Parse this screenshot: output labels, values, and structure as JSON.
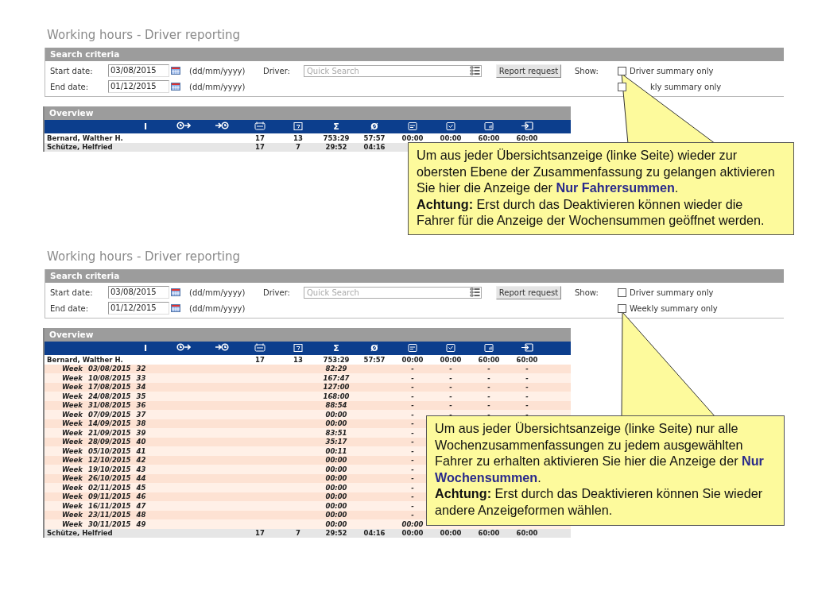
{
  "screens": [
    {
      "title": "Working hours - Driver reporting",
      "search": {
        "heading": "Search criteria",
        "start_label": "Start date:",
        "start_value": "03/08/2015",
        "start_format": "(dd/mm/yyyy)",
        "end_label": "End date:",
        "end_value": "01/12/2015",
        "end_format": "(dd/mm/yyyy)",
        "driver_label": "Driver:",
        "driver_placeholder": "Quick Search",
        "button": "Report request",
        "show_label": "Show:",
        "options": [
          {
            "label": "Driver summary only",
            "checked": false
          },
          {
            "label": "kly summary only",
            "checked": false
          }
        ]
      },
      "overview": {
        "heading": "Overview",
        "columns": [
          {
            "kind": "text",
            "label": "I"
          },
          {
            "kind": "icon"
          },
          {
            "kind": "icon"
          },
          {
            "kind": "icon"
          },
          {
            "kind": "icon"
          },
          {
            "kind": "text",
            "label": "Σ"
          },
          {
            "kind": "text",
            "label": "Ø"
          },
          {
            "kind": "icon"
          },
          {
            "kind": "icon"
          },
          {
            "kind": "icon"
          },
          {
            "kind": "icon"
          }
        ],
        "rows": [
          {
            "kind": "driver",
            "name": "Bernard, Walther H.",
            "cells": [
              null,
              null,
              null,
              "17",
              "13",
              "753:29",
              "57:57",
              "00:00",
              "00:00",
              "60:00",
              "60:00"
            ]
          },
          {
            "kind": "driver",
            "name": "Schütze, Helfried",
            "cells": [
              null,
              null,
              null,
              "17",
              "7",
              "29:52",
              "04:16",
              null,
              null,
              null,
              null
            ]
          }
        ]
      }
    },
    {
      "title": "Working hours - Driver reporting",
      "search": {
        "heading": "Search criteria",
        "start_label": "Start date:",
        "start_value": "03/08/2015",
        "start_format": "(dd/mm/yyyy)",
        "end_label": "End date:",
        "end_value": "01/12/2015",
        "end_format": "(dd/mm/yyyy)",
        "driver_label": "Driver:",
        "driver_placeholder": "Quick Search",
        "button": "Report request",
        "show_label": "Show:",
        "options": [
          {
            "label": "Driver summary only",
            "checked": false
          },
          {
            "label": "Weekly summary only",
            "checked": false
          }
        ]
      },
      "overview": {
        "heading": "Overview",
        "columns": [
          {
            "kind": "text",
            "label": "I"
          },
          {
            "kind": "icon"
          },
          {
            "kind": "icon"
          },
          {
            "kind": "icon"
          },
          {
            "kind": "icon"
          },
          {
            "kind": "text",
            "label": "Σ"
          },
          {
            "kind": "text",
            "label": "Ø"
          },
          {
            "kind": "icon"
          },
          {
            "kind": "icon"
          },
          {
            "kind": "icon"
          },
          {
            "kind": "icon"
          }
        ],
        "rows": [
          {
            "kind": "driver",
            "name": "Bernard, Walther H.",
            "cells": [
              null,
              null,
              null,
              "17",
              "13",
              "753:29",
              "57:57",
              "00:00",
              "00:00",
              "60:00",
              "60:00"
            ]
          },
          {
            "kind": "week",
            "label": "Week",
            "date": "03/08/2015",
            "number": "32",
            "cells": [
              null,
              null,
              null,
              null,
              null,
              "82:29",
              null,
              "-",
              "-",
              "-",
              "-"
            ]
          },
          {
            "kind": "week",
            "label": "Week",
            "date": "10/08/2015",
            "number": "33",
            "cells": [
              null,
              null,
              null,
              null,
              null,
              "167:47",
              null,
              "-",
              "-",
              "-",
              "-"
            ]
          },
          {
            "kind": "week",
            "label": "Week",
            "date": "17/08/2015",
            "number": "34",
            "cells": [
              null,
              null,
              null,
              null,
              null,
              "127:00",
              null,
              "-",
              "-",
              "-",
              "-"
            ]
          },
          {
            "kind": "week",
            "label": "Week",
            "date": "24/08/2015",
            "number": "35",
            "cells": [
              null,
              null,
              null,
              null,
              null,
              "168:00",
              null,
              "-",
              "-",
              "-",
              "-"
            ]
          },
          {
            "kind": "week",
            "label": "Week",
            "date": "31/08/2015",
            "number": "36",
            "cells": [
              null,
              null,
              null,
              null,
              null,
              "88:54",
              null,
              "-",
              "-",
              "-",
              "-"
            ]
          },
          {
            "kind": "week",
            "label": "Week",
            "date": "07/09/2015",
            "number": "37",
            "cells": [
              null,
              null,
              null,
              null,
              null,
              "00:00",
              null,
              "-",
              "-",
              "-",
              "-"
            ]
          },
          {
            "kind": "week",
            "label": "Week",
            "date": "14/09/2015",
            "number": "38",
            "cells": [
              null,
              null,
              null,
              null,
              null,
              "00:00",
              null,
              "-",
              null,
              null,
              null
            ]
          },
          {
            "kind": "week",
            "label": "Week",
            "date": "21/09/2015",
            "number": "39",
            "cells": [
              null,
              null,
              null,
              null,
              null,
              "83:51",
              null,
              "-",
              null,
              null,
              null
            ]
          },
          {
            "kind": "week",
            "label": "Week",
            "date": "28/09/2015",
            "number": "40",
            "cells": [
              null,
              null,
              null,
              null,
              null,
              "35:17",
              null,
              "-",
              null,
              null,
              null
            ]
          },
          {
            "kind": "week",
            "label": "Week",
            "date": "05/10/2015",
            "number": "41",
            "cells": [
              null,
              null,
              null,
              null,
              null,
              "00:11",
              null,
              "-",
              null,
              null,
              null
            ]
          },
          {
            "kind": "week",
            "label": "Week",
            "date": "12/10/2015",
            "number": "42",
            "cells": [
              null,
              null,
              null,
              null,
              null,
              "00:00",
              null,
              "-",
              null,
              null,
              null
            ]
          },
          {
            "kind": "week",
            "label": "Week",
            "date": "19/10/2015",
            "number": "43",
            "cells": [
              null,
              null,
              null,
              null,
              null,
              "00:00",
              null,
              "-",
              null,
              null,
              null
            ]
          },
          {
            "kind": "week",
            "label": "Week",
            "date": "26/10/2015",
            "number": "44",
            "cells": [
              null,
              null,
              null,
              null,
              null,
              "00:00",
              null,
              "-",
              null,
              null,
              null
            ]
          },
          {
            "kind": "week",
            "label": "Week",
            "date": "02/11/2015",
            "number": "45",
            "cells": [
              null,
              null,
              null,
              null,
              null,
              "00:00",
              null,
              "-",
              null,
              null,
              null
            ]
          },
          {
            "kind": "week",
            "label": "Week",
            "date": "09/11/2015",
            "number": "46",
            "cells": [
              null,
              null,
              null,
              null,
              null,
              "00:00",
              null,
              "-",
              null,
              null,
              null
            ]
          },
          {
            "kind": "week",
            "label": "Week",
            "date": "16/11/2015",
            "number": "47",
            "cells": [
              null,
              null,
              null,
              null,
              null,
              "00:00",
              null,
              "-",
              null,
              null,
              null
            ]
          },
          {
            "kind": "week",
            "label": "Week",
            "date": "23/11/2015",
            "number": "48",
            "cells": [
              null,
              null,
              null,
              null,
              null,
              "00:00",
              null,
              "-",
              null,
              null,
              null
            ]
          },
          {
            "kind": "week",
            "label": "Week",
            "date": "30/11/2015",
            "number": "49",
            "cells": [
              null,
              null,
              null,
              null,
              null,
              "00:00",
              null,
              "00:00",
              null,
              null,
              null
            ]
          },
          {
            "kind": "driver",
            "name": "Schütze, Helfried",
            "cells": [
              null,
              null,
              null,
              "17",
              "7",
              "29:52",
              "04:16",
              "00:00",
              "00:00",
              "60:00",
              "60:00"
            ]
          }
        ]
      }
    }
  ],
  "callouts": [
    {
      "paragraphs": [
        "Um aus jeder Übersichtsanzeige (linke Seite) wieder zur obersten Ebene der Zusammenfassung zu gelangen aktivieren Sie hier die Anzeige der **Nur Fahrersummen**.",
        "**Achtung:** Erst durch das Deaktivieren können wieder die Fahrer für die Anzeige der Wochensummen geöffnet werden."
      ]
    },
    {
      "paragraphs": [
        "Um aus jeder Übersichtsanzeige (linke Seite) nur alle Wochenzusammenfassungen zu jedem ausgewählten Fahrer zu erhalten aktivieren Sie hier die Anzeige der **Nur Wochensummen**.",
        "**Achtung:** Erst durch das Deaktivieren können Sie wieder andere Anzeigeformen wählen."
      ]
    }
  ]
}
